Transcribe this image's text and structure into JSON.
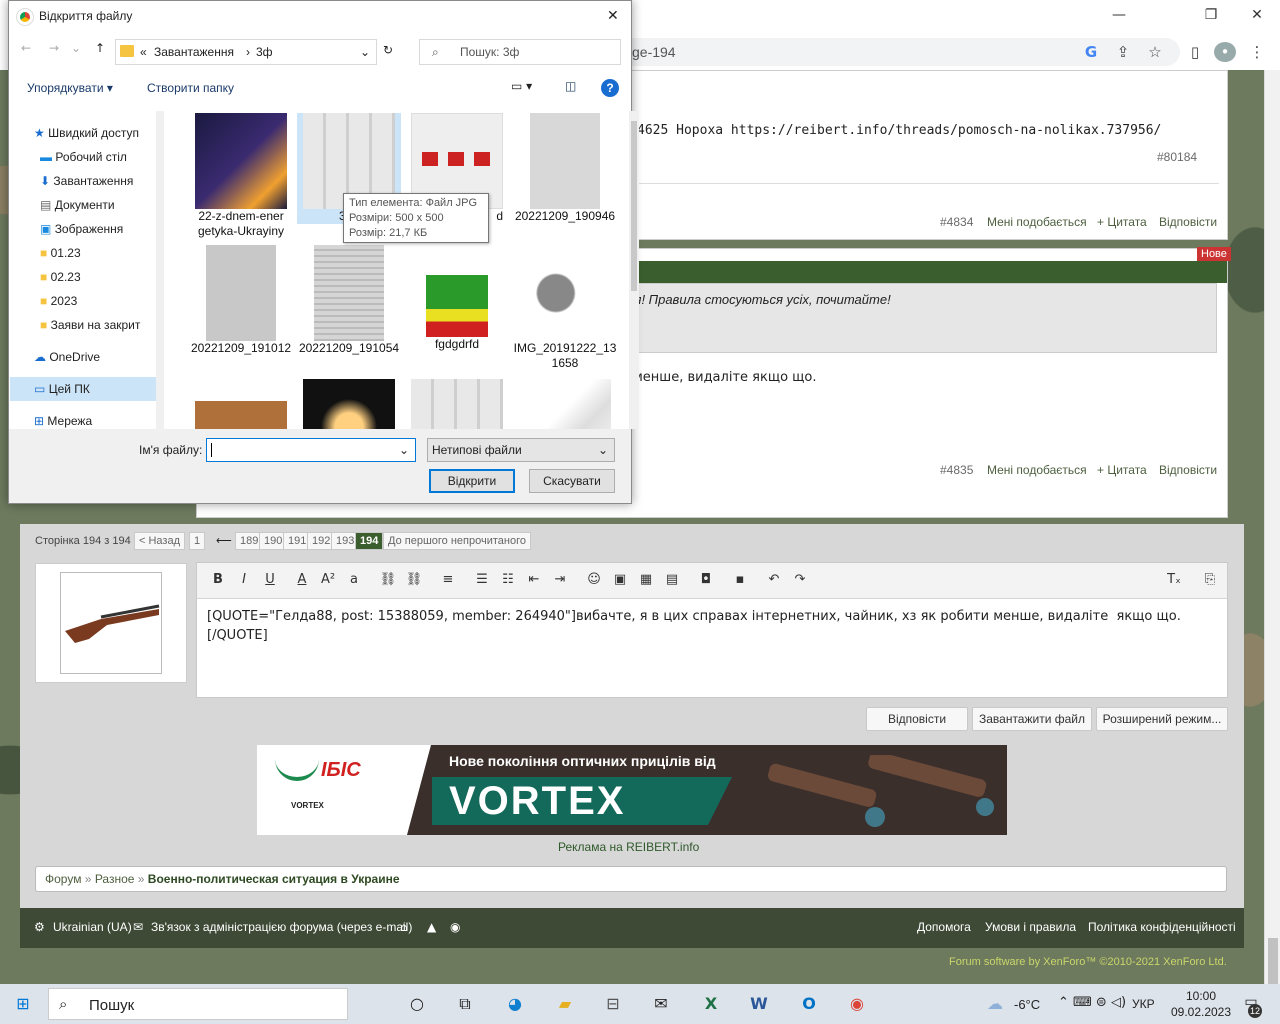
{
  "browser": {
    "address_fragment": "ge-194",
    "icons": [
      "google-icon",
      "share-icon",
      "star-icon",
      "sidebar-icon",
      "avatar-icon",
      "menu-icon"
    ],
    "window_controls": [
      "minimize",
      "restore",
      "close"
    ]
  },
  "forum": {
    "post1": {
      "text_fragment": "4625 Нороха https://reibert.info/threads/pomosch-na-nolikax.737956/",
      "ref": "#80184",
      "number": "#4834",
      "like": "Мені подобається",
      "quote": "+ Цитата",
      "reply": "Відповісти"
    },
    "post2": {
      "badge": "Нове",
      "notice_fragment": "ся! Правила стосуються усіх, почитайте!",
      "text_fragment": "менше, видаліте якщо що.",
      "number": "#4835",
      "like": "Мені подобається",
      "quote": "+ Цитата",
      "reply": "Відповісти"
    },
    "pagination": {
      "label": "Сторінка 194 з 194",
      "prev": "< Назад",
      "first": "1",
      "ellipsis": "⟵",
      "pages": [
        "189",
        "190",
        "191",
        "192",
        "193"
      ],
      "current": "194",
      "first_unread": "До першого непрочитаного"
    },
    "editor": {
      "content": "[QUOTE=\"Гелда88, post: 15388059, member: 264940\"]вибачте, я в цих справах інтернетних, чайник, хз як робити менше, видаліте  якщо що.\n[/QUOTE]",
      "tools": [
        "B",
        "I",
        "U",
        "A",
        "A²",
        "a",
        "🔗",
        "⛓",
        "≡",
        "•≡",
        "1≡",
        "⇤",
        "⇥",
        "☺",
        "🖼",
        "▦",
        "▤",
        "📷",
        "💾",
        "↶",
        "↷",
        "Tx",
        "⎘"
      ]
    },
    "buttons": {
      "reply": "Відповісти",
      "upload": "Завантажити файл",
      "advanced": "Розширений режим..."
    },
    "ad": {
      "brand": "ІБІС",
      "headline": "Нове покоління оптичних прицілів від",
      "product": "VORTEX",
      "small_logo": "VORTEX",
      "caption": "Реклама на REIBERT.info"
    },
    "breadcrumb": [
      "Форум",
      "Разное",
      "Военно-политическая ситуация в Украине"
    ],
    "footer": {
      "language": "Ukrainian (UA)",
      "contact": "Зв'язок з адміністрацією форума (через e-mail)",
      "help": "Допомога",
      "terms": "Умови і правила",
      "privacy": "Політика конфіденційності",
      "copyright": "Forum software by XenForo™ ©2010-2021 XenForo Ltd."
    }
  },
  "dialog": {
    "title": "Відкриття файлу",
    "path": [
      "«",
      "Завантаження",
      "›",
      "3ф"
    ],
    "search_placeholder": "Пошук: 3ф",
    "organize": "Упорядкувати ▾",
    "new_folder": "Створити папку",
    "nav": [
      {
        "label": "Швидкий доступ",
        "pin": false
      },
      {
        "label": "Робочий стіл",
        "pin": true
      },
      {
        "label": "Завантаження",
        "pin": true
      },
      {
        "label": "Документи",
        "pin": true
      },
      {
        "label": "Зображення",
        "pin": true
      },
      {
        "label": "01.23",
        "pin": false
      },
      {
        "label": "02.23",
        "pin": false
      },
      {
        "label": "2023",
        "pin": false
      },
      {
        "label": "Заяви на закрит",
        "pin": false
      },
      {
        "label": "OneDrive",
        "pin": false
      },
      {
        "label": "Цей ПК",
        "pin": false
      },
      {
        "label": "Мережа",
        "pin": false
      }
    ],
    "files": [
      {
        "name": "22-z-dnem-energetyka-Ukrayiny",
        "line1": "22-z-dnem-ener",
        "line2": "getyka-Ukrayiny"
      },
      {
        "name": "301...",
        "line1": "301",
        "line2": ""
      },
      {
        "name": "...d",
        "line1": "d",
        "line2": ""
      },
      {
        "name": "20221209_190946",
        "line1": "20221209_190946",
        "line2": ""
      },
      {
        "name": "20221209_191012",
        "line1": "20221209_191012",
        "line2": ""
      },
      {
        "name": "20221209_191054",
        "line1": "20221209_191054",
        "line2": ""
      },
      {
        "name": "fgdgdrfd",
        "line1": "fgdgdrfd",
        "line2": ""
      },
      {
        "name": "IMG_20191222_131658",
        "line1": "IMG_20191222_13",
        "line2": "1658"
      }
    ],
    "tooltip": {
      "type": "Тип елемента: Файл JPG",
      "dims": "Розміри: 500 x 500",
      "size": "Розмір: 21,7 КБ"
    },
    "filename_label": "Ім'я файлу:",
    "filename_value": "",
    "filetype": "Нетипові файли",
    "open": "Відкрити",
    "cancel": "Скасувати"
  },
  "taskbar": {
    "search": "Пошук",
    "weather": "-6°C",
    "lang": "УКР",
    "time": "10:00",
    "date": "09.02.2023",
    "notifications": "12"
  }
}
